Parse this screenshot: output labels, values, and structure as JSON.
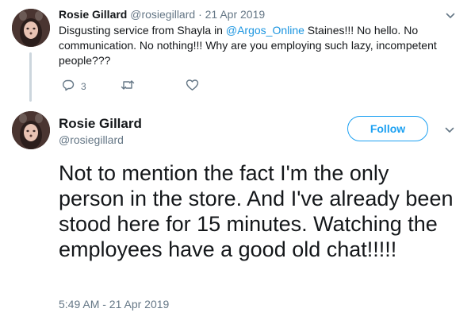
{
  "tweet1": {
    "name": "Rosie Gillard",
    "handle": "@rosiegillard",
    "separator": "·",
    "date": "21 Apr 2019",
    "text_before": "Disgusting service from Shayla in ",
    "mention": "@Argos_Online",
    "text_after": "  Staines!!! No hello. No communication. No nothing!!! Why are you employing such lazy, incompetent people???",
    "reply_count": "3",
    "icons": [
      "reply-icon",
      "retweet-icon",
      "like-icon",
      "chevron-down-icon"
    ]
  },
  "tweet2": {
    "name": "Rosie Gillard",
    "handle": "@rosiegillard",
    "follow_label": "Follow",
    "text": "Not to mention the fact I'm the only person in the store. And I've already been stood here for 15 minutes. Watching the employees have a good old chat!!!!!",
    "timestamp": "5:49 AM - 21 Apr 2019",
    "icons": [
      "chevron-down-icon"
    ]
  },
  "colors": {
    "link": "#1b95e0",
    "follow": "#1da1f2",
    "secondary_text": "#657786",
    "thread_line": "#ccd6dd"
  }
}
